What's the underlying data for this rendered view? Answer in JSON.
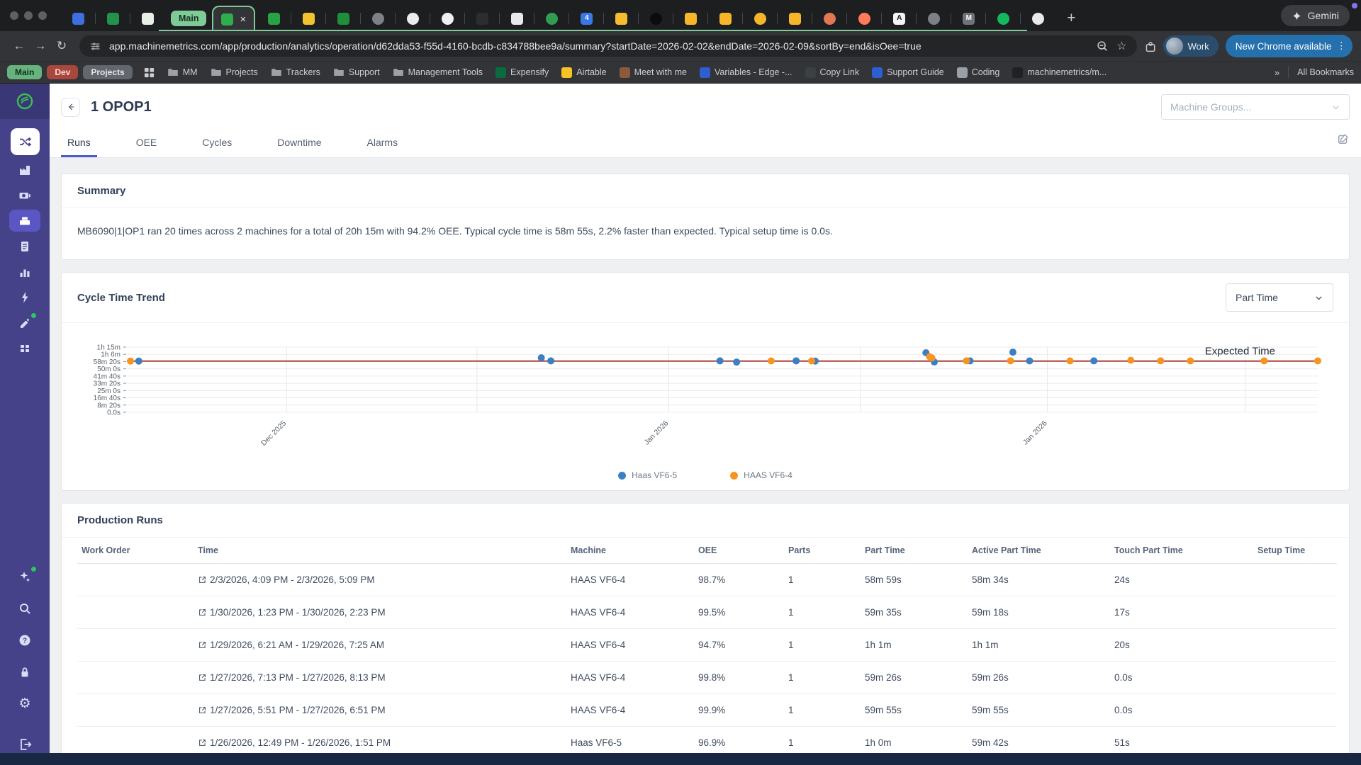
{
  "browser": {
    "tab_group_label": "Main",
    "new_tab_button": "+",
    "gemini_label": "Gemini",
    "active_tab_close": "×",
    "pinned_tabs_before_group": [
      {
        "name": "blue-app-tab",
        "color": "#3d6fe0"
      },
      {
        "name": "sheets-tab",
        "color": "#23934c"
      },
      {
        "name": "doc-tab",
        "color": "#e7efe7"
      }
    ],
    "active_tab_favicon": {
      "name": "machinemetrics-active-tab",
      "color": "#2fae4c"
    },
    "pinned_tabs_after_group": [
      {
        "name": "machinemetrics-tab",
        "color": "#27a343"
      },
      {
        "name": "yellow-cube-tab",
        "color": "#f2c230"
      },
      {
        "name": "machinemetrics-tab-2",
        "color": "#1f8f3a"
      },
      {
        "name": "globe-tab",
        "color": "#7d8187",
        "round": true
      },
      {
        "name": "openai-tab",
        "color": "#ececec",
        "round": true
      },
      {
        "name": "github-tab",
        "color": "#f0f0f0",
        "round": true
      },
      {
        "name": "terminal-tab",
        "color": "#2b2d30"
      },
      {
        "name": "notion-tab",
        "color": "#e9e9e9"
      },
      {
        "name": "leaf-tab",
        "color": "#2f9e52",
        "round": true
      },
      {
        "name": "calendar-tab",
        "color": "#3b78e7",
        "glyph": "4",
        "glyph_color": "#ffffff"
      },
      {
        "name": "drive-tab",
        "color": "#f6bb2e"
      },
      {
        "name": "dark-circle-tab",
        "color": "#0b0c0d",
        "round": true
      },
      {
        "name": "yellow-square-tab",
        "color": "#f7b529"
      },
      {
        "name": "yellow-square-tab-2",
        "color": "#f7b529"
      },
      {
        "name": "yellow-loading-tab",
        "color": "#f7b529",
        "round": true
      },
      {
        "name": "yellow-square-tab-3",
        "color": "#f7b529"
      },
      {
        "name": "claude-starburst-tab",
        "color": "#e07856",
        "round": true
      },
      {
        "name": "hubspot-tab",
        "color": "#ff7a59",
        "round": true
      },
      {
        "name": "asana-tab",
        "color": "#f4f4f4",
        "glyph": "A",
        "glyph_color": "#111111"
      },
      {
        "name": "globe-tab-2",
        "color": "#7d8187",
        "round": true
      },
      {
        "name": "m-tab",
        "color": "#6f7277",
        "glyph": "M",
        "glyph_color": "#ffffff"
      },
      {
        "name": "green-ring-tab",
        "color": "#15b85e",
        "round": true
      },
      {
        "name": "cloud-tab",
        "color": "#e8eaed",
        "round": true
      }
    ],
    "toolbar": {
      "url": "app.machinemetrics.com/app/production/analytics/operation/d62dda53-f55d-4160-bcdb-c834788bee9a/summary?startDate=2026-02-02&endDate=2026-02-09&sortBy=end&isOee=true",
      "profile_label": "Work",
      "update_chip": "New Chrome available",
      "menu_dots": "⋮",
      "bookmark_star": "☆"
    },
    "bookmarks": {
      "pills": [
        {
          "label": "Main",
          "bg": "#67b37d",
          "fg": "#10301f"
        },
        {
          "label": "Dev",
          "bg": "#a8473d",
          "fg": "#ffd9d2"
        },
        {
          "label": "Projects",
          "bg": "#62666d",
          "fg": "#e6e8ea"
        }
      ],
      "folders": [
        "MM",
        "Projects",
        "Trackers",
        "Support",
        "Management Tools"
      ],
      "links": [
        {
          "label": "Expensify",
          "color": "#0b6b3f"
        },
        {
          "label": "Airtable",
          "color": "#f7c325"
        },
        {
          "label": "Meet with me",
          "color": "#8a5a3b"
        },
        {
          "label": "Variables - Edge -...",
          "color": "#2d5fd0"
        },
        {
          "label": "Copy Link",
          "color": "#3c4043"
        },
        {
          "label": "Support Guide",
          "color": "#2d5fd0"
        },
        {
          "label": "Coding",
          "color": "#9aa0a6"
        },
        {
          "label": "machinemetrics/m...",
          "color": "#202124"
        }
      ],
      "overflow": "»",
      "all_bookmarks": "All Bookmarks"
    }
  },
  "sidebar": {
    "logo_name": "machinemetrics-logo",
    "logo_color": "#3bbf54",
    "shuffle_name": "shuffle-icon",
    "items": [
      {
        "name": "machines-icon",
        "icon": "factory"
      },
      {
        "name": "cameras-icon",
        "icon": "camera"
      },
      {
        "name": "operations-icon",
        "icon": "machine",
        "active": true
      },
      {
        "name": "reports-icon",
        "icon": "report"
      },
      {
        "name": "analytics-icon",
        "icon": "barchart"
      },
      {
        "name": "events-icon",
        "icon": "bolt"
      },
      {
        "name": "maintenance-icon",
        "icon": "tool",
        "badge": true
      },
      {
        "name": "apps-icon",
        "icon": "grid"
      }
    ],
    "bottom_items": [
      {
        "name": "ai-assistant-icon",
        "icon": "sparkle",
        "badge": true
      },
      {
        "name": "search-icon",
        "icon": "search"
      },
      {
        "name": "help-icon",
        "icon": "help"
      },
      {
        "name": "lock-icon",
        "icon": "lock"
      },
      {
        "name": "settings-gear-icon",
        "icon": "gear"
      }
    ],
    "logout": {
      "name": "logout-icon",
      "icon": "logout"
    }
  },
  "page": {
    "title": "1 OPOP1",
    "machine_groups_placeholder": "Machine Groups...",
    "tabs": [
      {
        "label": "Runs",
        "active": true
      },
      {
        "label": "OEE",
        "active": false
      },
      {
        "label": "Cycles",
        "active": false
      },
      {
        "label": "Downtime",
        "active": false
      },
      {
        "label": "Alarms",
        "active": false
      }
    ],
    "summary": {
      "title": "Summary",
      "text": "MB6090|1|OP1 ran 20 times across 2 machines for a total of 20h 15m with 94.2% OEE. Typical cycle time is 58m 55s, 2.2% faster than expected. Typical setup time is 0.0s."
    },
    "chart_card": {
      "title": "Cycle Time Trend",
      "metric_select_value": "Part Time"
    },
    "production_runs": {
      "title": "Production Runs",
      "columns": [
        "Work Order",
        "Time",
        "Machine",
        "OEE",
        "Parts",
        "Part Time",
        "Active Part Time",
        "Touch Part Time",
        "Setup Time"
      ],
      "rows": [
        {
          "work_order": "",
          "time": "2/3/2026, 4:09 PM - 2/3/2026, 5:09 PM",
          "machine": "HAAS VF6-4",
          "oee": "98.7%",
          "parts": "1",
          "part_time": "58m 59s",
          "active_part_time": "58m 34s",
          "touch_part_time": "24s",
          "setup_time": ""
        },
        {
          "work_order": "",
          "time": "1/30/2026, 1:23 PM - 1/30/2026, 2:23 PM",
          "machine": "HAAS VF6-4",
          "oee": "99.5%",
          "parts": "1",
          "part_time": "59m 35s",
          "active_part_time": "59m 18s",
          "touch_part_time": "17s",
          "setup_time": ""
        },
        {
          "work_order": "",
          "time": "1/29/2026, 6:21 AM - 1/29/2026, 7:25 AM",
          "machine": "HAAS VF6-4",
          "oee": "94.7%",
          "parts": "1",
          "part_time": "1h 1m",
          "active_part_time": "1h 1m",
          "touch_part_time": "20s",
          "setup_time": ""
        },
        {
          "work_order": "",
          "time": "1/27/2026, 7:13 PM - 1/27/2026, 8:13 PM",
          "machine": "HAAS VF6-4",
          "oee": "99.8%",
          "parts": "1",
          "part_time": "59m 26s",
          "active_part_time": "59m 26s",
          "touch_part_time": "0.0s",
          "setup_time": ""
        },
        {
          "work_order": "",
          "time": "1/27/2026, 5:51 PM - 1/27/2026, 6:51 PM",
          "machine": "HAAS VF6-4",
          "oee": "99.9%",
          "parts": "1",
          "part_time": "59m 55s",
          "active_part_time": "59m 55s",
          "touch_part_time": "0.0s",
          "setup_time": ""
        },
        {
          "work_order": "",
          "time": "1/26/2026, 12:49 PM - 1/26/2026, 1:51 PM",
          "machine": "Haas VF6-5",
          "oee": "96.9%",
          "parts": "1",
          "part_time": "1h 0m",
          "active_part_time": "59m 42s",
          "touch_part_time": "51s",
          "setup_time": ""
        }
      ]
    }
  },
  "chart_data": {
    "type": "scatter",
    "title": "Cycle Time Trend",
    "xlabel": "",
    "ylabel": "",
    "y_axis": {
      "ticks_top_to_bottom": [
        "1h 15m",
        "1h 6m",
        "58m 20s",
        "50m 0s",
        "41m 40s",
        "33m 20s",
        "25m 0s",
        "16m 40s",
        "8m 20s",
        "0.0s"
      ],
      "range_seconds": [
        0,
        4500
      ],
      "grid": true
    },
    "x_axis": {
      "tick_labels": [
        {
          "label": "Dec 2025",
          "frac": 0.134
        },
        {
          "label": "Jan 2026",
          "frac": 0.455
        },
        {
          "label": "Jan 2026",
          "frac": 0.773
        }
      ],
      "gridline_fracs": [
        0.134,
        0.294,
        0.455,
        0.616,
        0.773,
        0.939
      ]
    },
    "expected_time": {
      "label": "Expected Time",
      "seconds": 3535,
      "color": "#b2453c"
    },
    "series": [
      {
        "name": "Haas VF6-5",
        "color": "#3b7fc4",
        "points": [
          [
            0.01,
            3535
          ],
          [
            0.348,
            3760
          ],
          [
            0.356,
            3545
          ],
          [
            0.498,
            3550
          ],
          [
            0.512,
            3465
          ],
          [
            0.562,
            3550
          ],
          [
            0.578,
            3535
          ],
          [
            0.671,
            4110
          ],
          [
            0.678,
            3470
          ],
          [
            0.708,
            3545
          ],
          [
            0.744,
            4150
          ],
          [
            0.758,
            3545
          ],
          [
            0.812,
            3550
          ]
        ]
      },
      {
        "name": "HAAS VF6-4",
        "color": "#f79420",
        "points": [
          [
            0.003,
            3535
          ],
          [
            0.541,
            3545
          ],
          [
            0.575,
            3545
          ],
          [
            0.674,
            3840
          ],
          [
            0.676,
            3745
          ],
          [
            0.705,
            3550
          ],
          [
            0.742,
            3550
          ],
          [
            0.792,
            3545
          ],
          [
            0.843,
            3590
          ],
          [
            0.868,
            3550
          ],
          [
            0.893,
            3545
          ],
          [
            0.955,
            3545
          ],
          [
            1.0,
            3545
          ]
        ]
      }
    ],
    "legend_position": "bottom-center"
  }
}
